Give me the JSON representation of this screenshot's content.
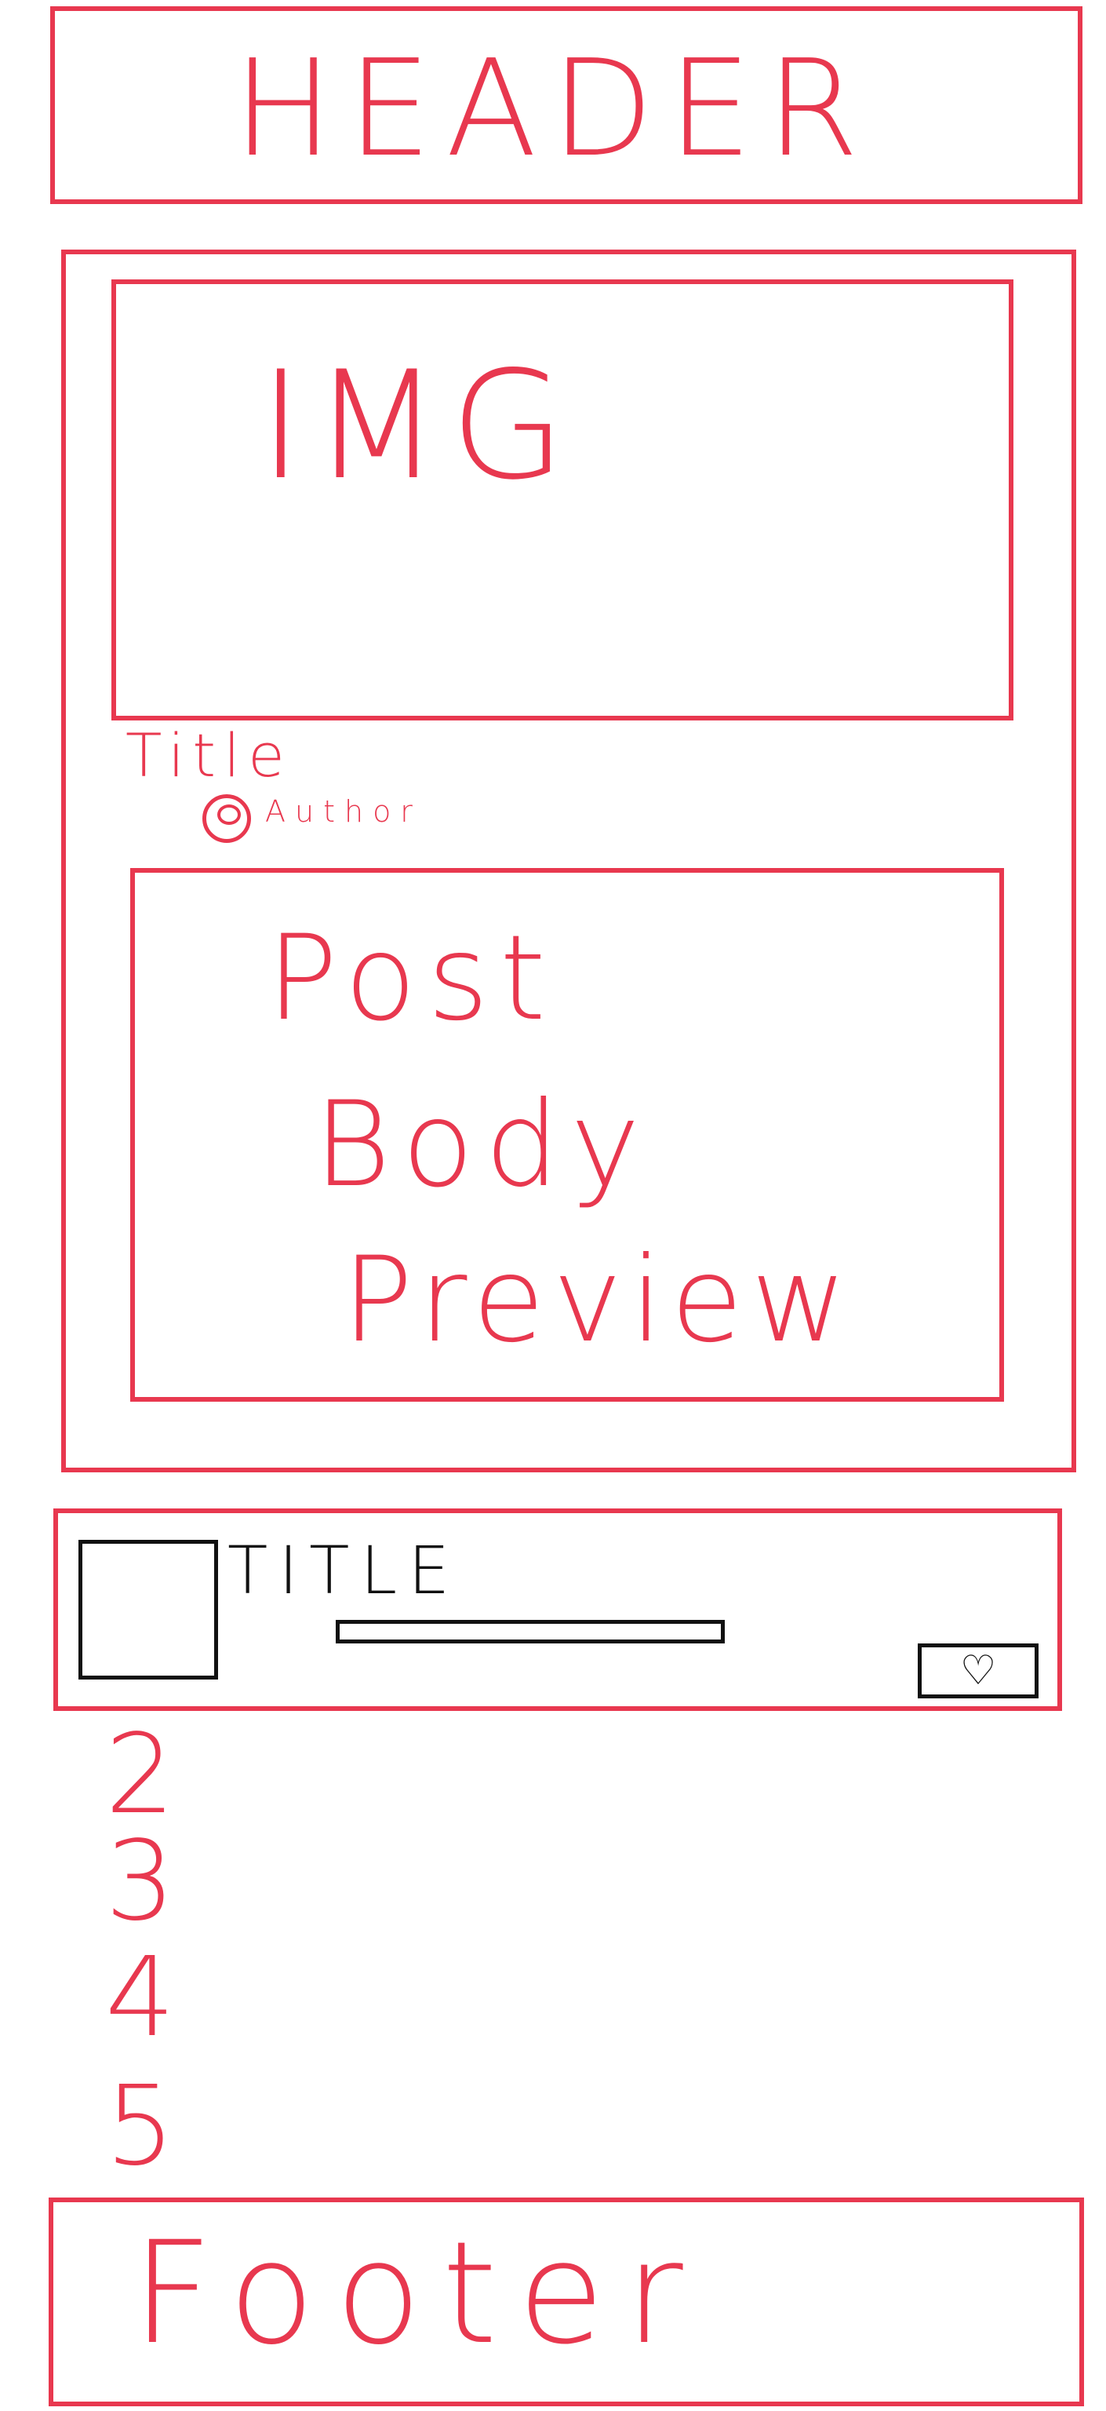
{
  "header": {
    "label": "HEADER"
  },
  "featured_post": {
    "image_label": "IMG",
    "title": "Title",
    "author": "Author",
    "body_preview_lines": [
      "Post",
      "Body",
      "Preview"
    ]
  },
  "compact_post": {
    "title": "TITLE",
    "like_icon": "heart-icon"
  },
  "list_numbers": [
    "2",
    "3",
    "4",
    "5"
  ],
  "footer": {
    "label": "Footer"
  },
  "colors": {
    "sketch_red": "#e8384f",
    "sketch_black": "#111111",
    "background": "#ffffff"
  }
}
